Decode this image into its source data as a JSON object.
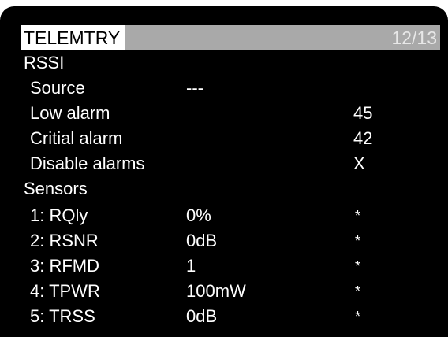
{
  "header": {
    "title": "TELEMTRY",
    "page": "12/13"
  },
  "rssi": {
    "section_label": "RSSI",
    "source_label": "Source",
    "source_value": "---",
    "low_alarm_label": "Low alarm",
    "low_alarm_value": "45",
    "critical_alarm_label": "Critial alarm",
    "critical_alarm_value": "42",
    "disable_alarms_label": "Disable alarms",
    "disable_alarms_value": "X"
  },
  "sensors": {
    "section_label": "Sensors",
    "items": [
      {
        "label": "1: RQly",
        "value": "0%",
        "flag": "*"
      },
      {
        "label": "2: RSNR",
        "value": "0dB",
        "flag": "*"
      },
      {
        "label": "3: RFMD",
        "value": "1",
        "flag": "*"
      },
      {
        "label": "4: TPWR",
        "value": "100mW",
        "flag": "*"
      },
      {
        "label": "5: TRSS",
        "value": "0dB",
        "flag": "*"
      }
    ]
  },
  "colors": {
    "background": "#000000",
    "text": "#ffffff",
    "titlebar": "#a9a9a9",
    "title_highlight": "#ffffff"
  }
}
